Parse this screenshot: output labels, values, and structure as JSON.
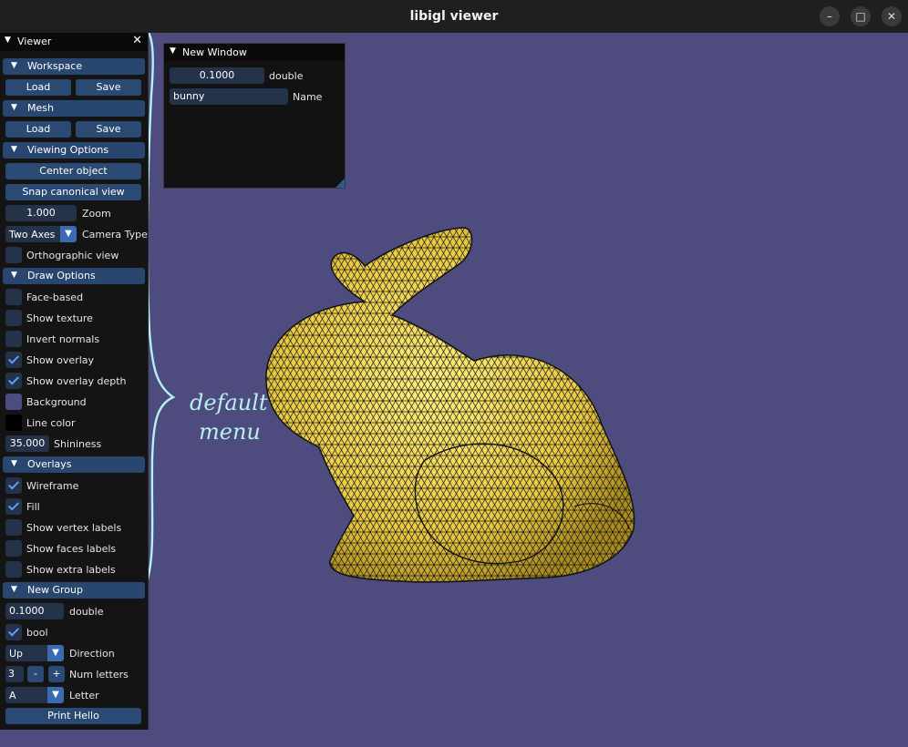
{
  "window": {
    "title": "libigl viewer"
  },
  "panel": {
    "title": "Viewer",
    "sections": {
      "workspace": {
        "label": "Workspace",
        "load": "Load",
        "save": "Save"
      },
      "mesh": {
        "label": "Mesh",
        "load": "Load",
        "save": "Save"
      },
      "viewing": {
        "label": "Viewing Options",
        "center": "Center object",
        "snap": "Snap canonical view",
        "zoom_value": "1.000",
        "zoom_label": "Zoom",
        "camera_value": "Two Axes",
        "camera_label": "Camera Type",
        "ortho_label": "Orthographic view"
      },
      "draw": {
        "label": "Draw Options",
        "face_based": "Face-based",
        "show_texture": "Show texture",
        "invert_normals": "Invert normals",
        "show_overlay": "Show overlay",
        "show_overlay_depth": "Show overlay depth",
        "background": "Background",
        "line_color": "Line color",
        "shininess_value": "35.000",
        "shininess_label": "Shininess"
      },
      "overlays": {
        "label": "Overlays",
        "wireframe": "Wireframe",
        "fill": "Fill",
        "vertex_labels": "Show vertex labels",
        "faces_labels": "Show faces labels",
        "extra_labels": "Show extra labels"
      },
      "new_group": {
        "label": "New Group",
        "double_value": "0.1000",
        "double_label": "double",
        "bool_label": "bool",
        "direction_value": "Up",
        "direction_label": "Direction",
        "num_value": "3",
        "minus": "-",
        "plus": "+",
        "num_label": "Num letters",
        "letter_value": "A",
        "letter_label": "Letter",
        "print": "Print Hello"
      }
    }
  },
  "new_window": {
    "title": "New Window",
    "double_value": "0.1000",
    "double_label": "double",
    "name_value": "bunny",
    "name_label": "Name"
  },
  "annotation": {
    "line1": "default",
    "line2": "menu"
  },
  "colors": {
    "background": "#4e4b7e",
    "mesh": "#f2d54e",
    "accent": "#2a4a73",
    "bracket": "#b8f0f0"
  },
  "icons": {
    "collapse": "triangle-down-icon",
    "close": "close-icon",
    "minimize": "minimize-icon",
    "maximize": "maximize-icon"
  }
}
